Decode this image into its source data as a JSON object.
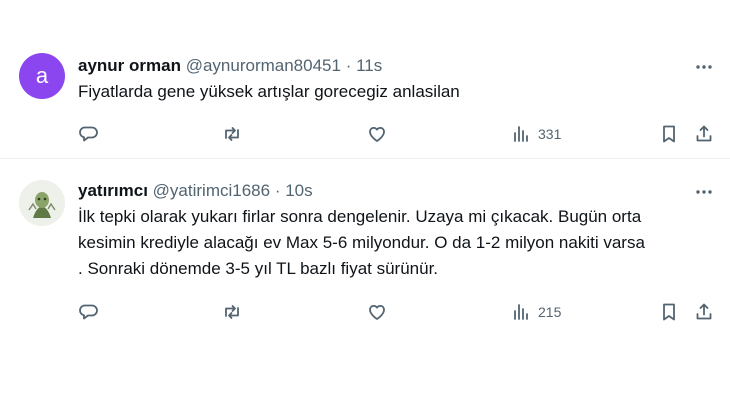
{
  "tweets": [
    {
      "avatar_letter": "a",
      "name": "aynur orman",
      "handle": "@aynurorman80451",
      "separator": "·",
      "time": "11s",
      "text_lines": [
        "Fiyatlarda gene yüksek artışlar gorecegiz anlasilan"
      ],
      "views": "331"
    },
    {
      "name": "yatırımcı",
      "handle": "@yatirimci1686",
      "separator": "·",
      "time": "10s",
      "text_lines": [
        "İlk tepki olarak yukarı firlar sonra dengelenir. Uzaya mi çıkacak. Bugün orta",
        "kesimin krediyle alacağı ev Max 5-6 milyondur. O da 1-2 milyon nakiti varsa",
        ". Sonraki dönemde 3-5 yıl TL bazlı fiyat sürünür."
      ],
      "views": "215"
    }
  ],
  "icons": [
    "more-icon",
    "reply-icon",
    "retweet-icon",
    "like-icon",
    "views-icon",
    "bookmark-icon",
    "share-icon"
  ],
  "colors": {
    "avatar_bg": "#8c46ef",
    "muted": "#536471",
    "text": "#0f1419",
    "divider": "#eff3f4"
  }
}
